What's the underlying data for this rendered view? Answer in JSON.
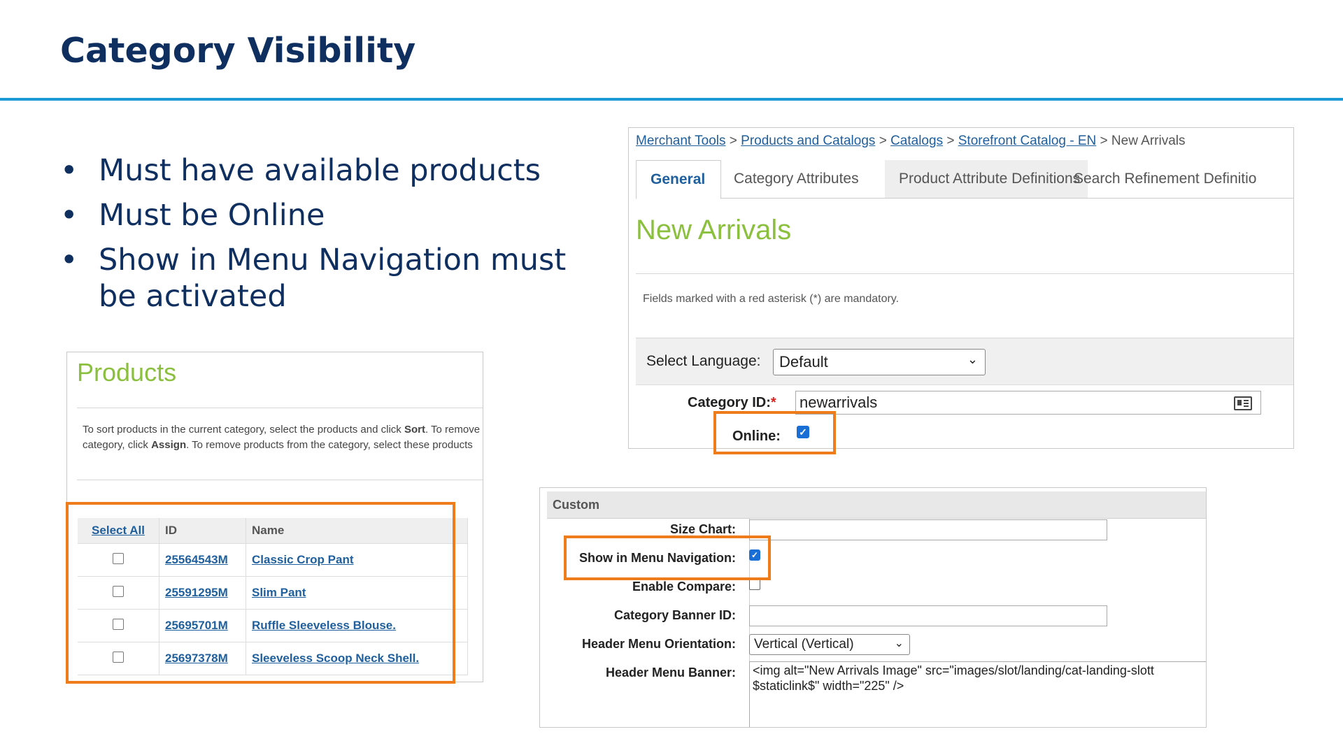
{
  "slide": {
    "title": "Category Visibility",
    "accent_color": "#1b9ad6",
    "title_color": "#0e2f5f",
    "highlight_color": "#ef7c1a",
    "bullets": [
      "Must have available products",
      "Must be Online",
      "Show in Menu Navigation must be activated"
    ]
  },
  "products": {
    "title": "Products",
    "desc_line1_a": "To sort products in the current category, select the products and click ",
    "desc_line1_b": "Sort",
    "desc_line1_c": ". To remove",
    "desc_line2_a": "category, click ",
    "desc_line2_b": "Assign",
    "desc_line2_c": ". To remove products from the category, select these products",
    "columns": {
      "select_all": "Select All",
      "id": "ID",
      "name": "Name"
    },
    "rows": [
      {
        "id": "25564543M",
        "name": "Classic Crop Pant"
      },
      {
        "id": "25591295M",
        "name": "Slim Pant"
      },
      {
        "id": "25695701M",
        "name": "Ruffle Sleeveless Blouse."
      },
      {
        "id": "25697378M",
        "name": "Sleeveless Scoop Neck Shell."
      }
    ]
  },
  "category": {
    "breadcrumb": {
      "items": [
        "Merchant Tools",
        "Products and Catalogs",
        "Catalogs",
        "Storefront Catalog - EN"
      ],
      "separator": ">",
      "current": "New Arrivals"
    },
    "tabs": [
      "General",
      "Category Attributes",
      "Product Attribute Definitions",
      "Search Refinement Definitio"
    ],
    "heading": "New Arrivals",
    "mandatory_note": "Fields marked with a red asterisk (*) are mandatory.",
    "language_label": "Select Language:",
    "language_value": "Default",
    "category_id_label": "Category ID:",
    "required_mark": "*",
    "category_id_value": "newarrivals",
    "online_label": "Online:",
    "online_checked": true
  },
  "custom": {
    "header": "Custom",
    "size_chart_label": "Size Chart:",
    "show_in_menu_label": "Show in Menu Navigation:",
    "show_in_menu_checked": true,
    "enable_compare_label": "Enable Compare:",
    "enable_compare_checked": false,
    "banner_id_label": "Category Banner ID:",
    "orientation_label": "Header Menu Orientation:",
    "orientation_value": "Vertical (Vertical)",
    "header_banner_label": "Header Menu Banner:",
    "header_banner_line1": "<img alt=\"New Arrivals Image\" src=\"images/slot/landing/cat-landing-slott",
    "header_banner_line2": "$staticlink$\" width=\"225\" />"
  },
  "icons": {
    "checkmark": "✓",
    "chevron": "⌄",
    "bullet": "•",
    "card_icon": "id-card-icon"
  }
}
